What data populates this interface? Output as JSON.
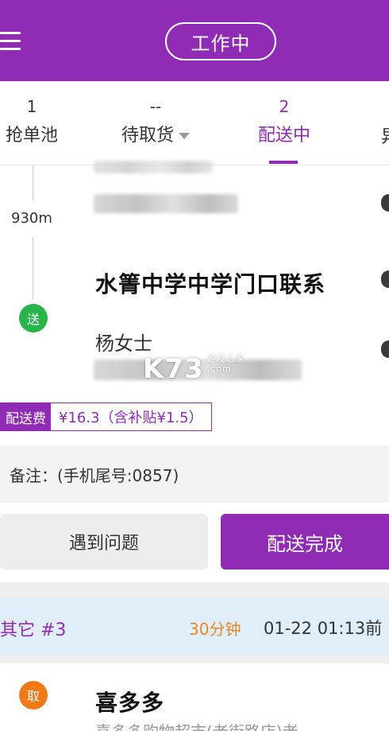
{
  "header": {
    "status_label": "工作中",
    "accent_color": "#8f2bb4"
  },
  "tabs": [
    {
      "count": "1",
      "label": "抢单池"
    },
    {
      "count": "--",
      "label": "待取货"
    },
    {
      "count": "2",
      "label": "配送中"
    },
    {
      "count": "",
      "label": "异"
    }
  ],
  "active_tab": "配送中",
  "current_order": {
    "distance": "930m",
    "deliver_badge": "送",
    "destination": "水箐中学中学门口联系",
    "contact_name": "杨女士",
    "watermark": {
      "brand": "K73",
      "sub": "游戏之家",
      "url": ".com"
    },
    "fee_label": "配送费",
    "fee_value": "¥16.3（含补贴¥1.5）",
    "note": "备注：(手机尾号:0857)",
    "problem_button": "遇到问题",
    "done_button": "配送完成"
  },
  "next_order": {
    "tag": "其它 #3",
    "minutes": "30分钟",
    "time": "01-22 01:13前",
    "pickup_badge": "取",
    "shop_name": "喜多多",
    "shop_address": "喜多多购物超市(老街路店)老"
  }
}
